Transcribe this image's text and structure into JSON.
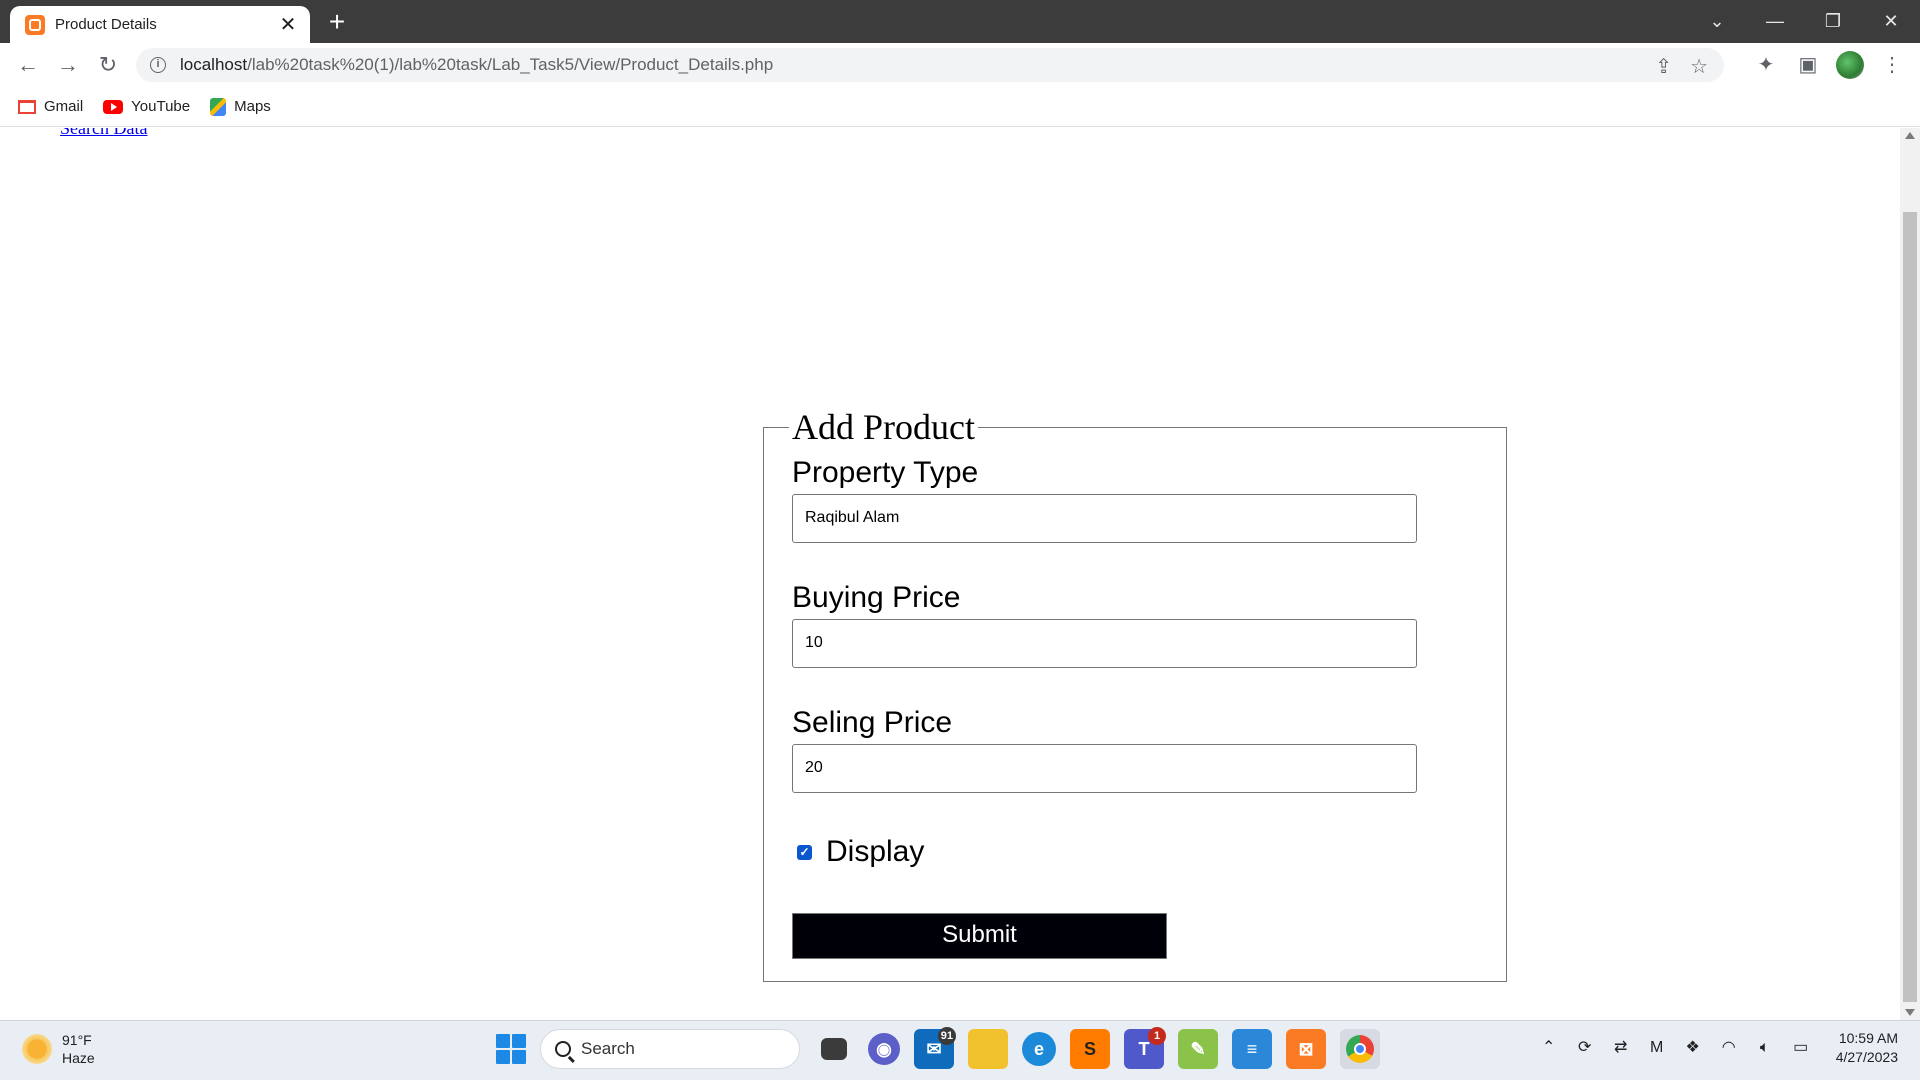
{
  "browser": {
    "tab_title": "Product Details",
    "tab_close": "✕",
    "new_tab": "+",
    "url_host": "localhost",
    "url_path": "/lab%20task%20(1)/lab%20task/Lab_Task5/View/Product_Details.php",
    "bookmarks": [
      {
        "label": "Gmail",
        "icon": "gmail-icon"
      },
      {
        "label": "YouTube",
        "icon": "youtube-icon"
      },
      {
        "label": "Maps",
        "icon": "maps-icon"
      }
    ]
  },
  "page": {
    "top_link": "Search Data",
    "form": {
      "legend": "Add Product",
      "property_type_label": "Property Type",
      "property_type_value": "Raqibul Alam",
      "buying_price_label": "Buying Price",
      "buying_price_value": "10",
      "selling_price_label": "Seling Price",
      "selling_price_value": "20",
      "display_label": "Display",
      "display_checked": true,
      "submit_label": "Submit"
    }
  },
  "taskbar": {
    "weather_temp": "91°F",
    "weather_desc": "Haze",
    "search_label": "Search",
    "mail_badge": "91",
    "teams_badge": "1",
    "time": "10:59 AM",
    "date": "4/27/2023"
  },
  "colors": {
    "accent": "#0b57d0",
    "submit_bg": "#000008",
    "titlebar": "#3c3c3c",
    "xampp_orange": "#fb7a24"
  }
}
